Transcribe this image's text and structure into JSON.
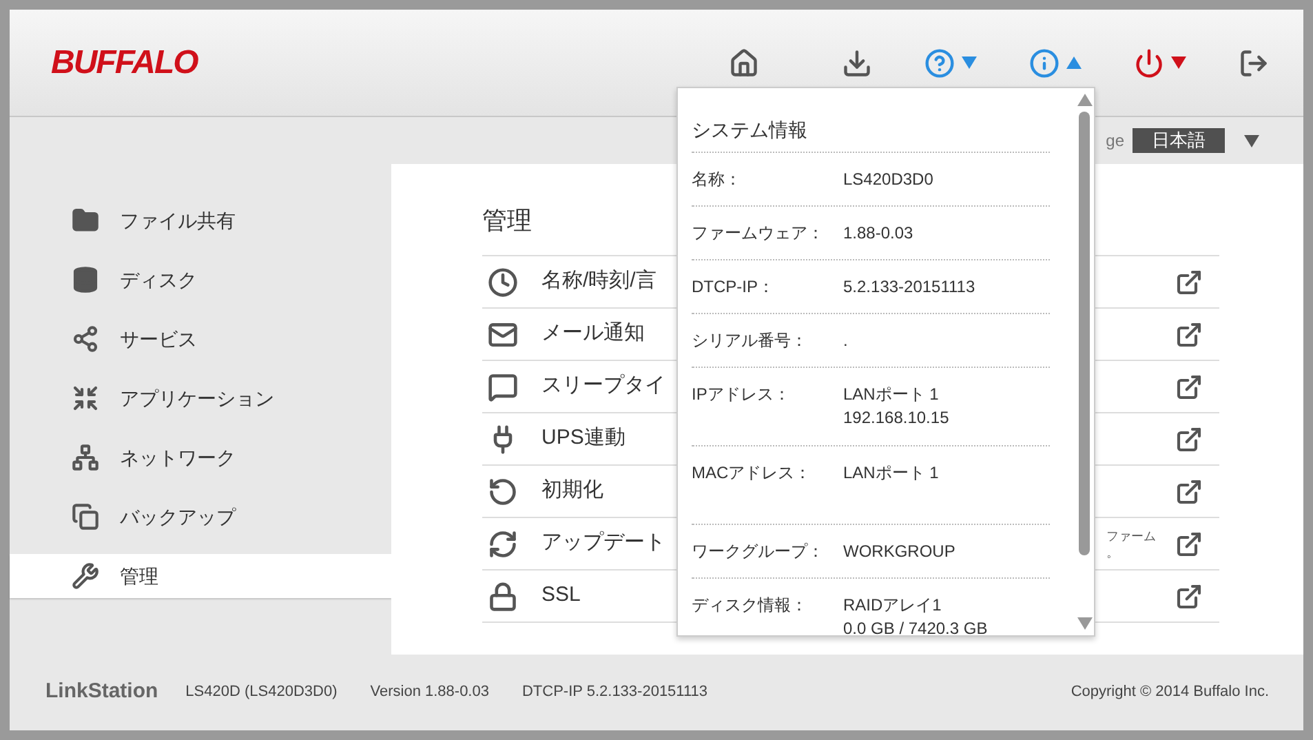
{
  "header": {
    "logo": "BUFFALO",
    "tools": [
      {
        "kind": "button"
      },
      {
        "kind": "button"
      },
      {
        "kind": "menu",
        "expanded": false
      },
      {
        "kind": "menu",
        "expanded": true
      },
      {
        "kind": "menu",
        "expanded": false
      },
      {
        "kind": "button"
      }
    ]
  },
  "language": {
    "label": "ge",
    "value": "日本語"
  },
  "sidebar": {
    "items": [
      {
        "label": "ファイル共有",
        "selected": false
      },
      {
        "label": "ディスク",
        "selected": false
      },
      {
        "label": "サービス",
        "selected": false
      },
      {
        "label": "アプリケーション",
        "selected": false
      },
      {
        "label": "ネットワーク",
        "selected": false
      },
      {
        "label": "バックアップ",
        "selected": false
      },
      {
        "label": "管理",
        "selected": true
      }
    ]
  },
  "main": {
    "title": "管理",
    "rows": [
      {
        "label": "名称/時刻/言"
      },
      {
        "label": "メール通知"
      },
      {
        "label": "スリープタイ"
      },
      {
        "label": "UPS連動"
      },
      {
        "label": "初期化"
      },
      {
        "label": "アップデート",
        "description": [
          "ファーム",
          "。"
        ]
      },
      {
        "label": "SSL"
      }
    ]
  },
  "system_info": {
    "title": "システム情報",
    "rows": [
      {
        "label": "名称：",
        "values": [
          "LS420D3D0"
        ]
      },
      {
        "label": "ファームウェア：",
        "values": [
          "1.88-0.03"
        ]
      },
      {
        "label": "DTCP-IP：",
        "values": [
          "5.2.133-20151113"
        ]
      },
      {
        "label": "シリアル番号：",
        "values": [
          "."
        ]
      },
      {
        "label": "IPアドレス：",
        "values": [
          "LANポート 1",
          "192.168.10.15"
        ]
      },
      {
        "label": "MACアドレス：",
        "values": [
          "LANポート 1"
        ],
        "tall": true
      },
      {
        "label": "ワークグループ：",
        "values": [
          "WORKGROUP"
        ]
      },
      {
        "label": "ディスク情報：",
        "values": [
          "RAIDアレイ1",
          "0.0 GB / 7420.3 GB"
        ]
      }
    ]
  },
  "footer": {
    "brand": "LinkStation",
    "model": "LS420D (LS420D3D0)",
    "version": "Version 1.88-0.03",
    "dtcp": "DTCP-IP 5.2.133-20151113",
    "copyright": "Copyright © 2014 Buffalo Inc."
  }
}
